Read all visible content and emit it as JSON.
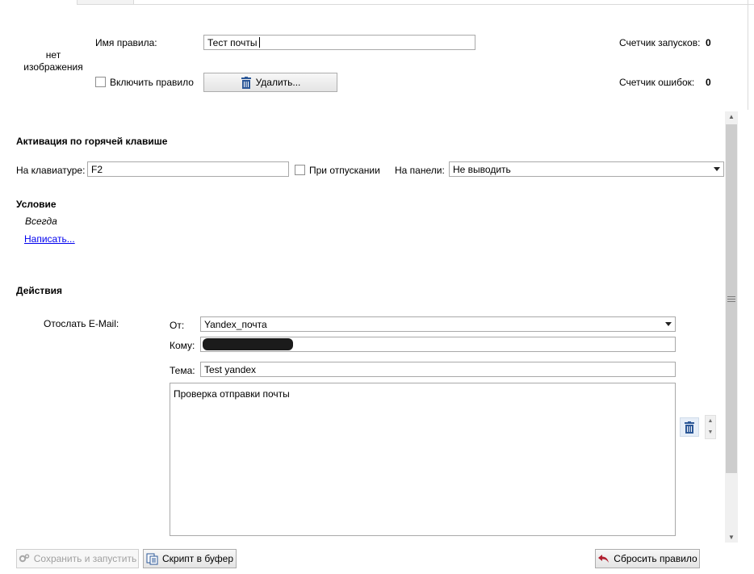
{
  "tabs": [
    "",
    ""
  ],
  "rule": {
    "no_image_text": "нет изображения",
    "name_label": "Имя правила:",
    "name_value": "Тест почты",
    "enable_label": "Включить правило",
    "delete_label": "Удалить...",
    "run_counter_label": "Счетчик запусков:",
    "run_counter_value": "0",
    "error_counter_label": "Счетчик ошибок:",
    "error_counter_value": "0"
  },
  "hotkey": {
    "section_title": "Активация по горячей клавише",
    "keyboard_label": "На клавиатуре:",
    "keyboard_value": "F2",
    "on_release_label": "При отпускании",
    "panel_label": "На панели:",
    "panel_value": "Не выводить"
  },
  "condition": {
    "section_title": "Условие",
    "value": "Всегда",
    "write_link": "Написать..."
  },
  "actions": {
    "section_title": "Действия",
    "action_name": "Отослать E-Mail:",
    "from_label": "От:",
    "from_value": "Yandex_почта",
    "to_label": "Кому:",
    "subject_label": "Тема:",
    "subject_value": "Test yandex",
    "body_value": "Проверка отправки почты"
  },
  "footer": {
    "save_run_label": "Сохранить и запустить",
    "copy_script_label": "Скрипт в буфер",
    "reset_label": "Сбросить правило"
  },
  "icons": {
    "delete": "trash-icon",
    "save_run": "gear-icon",
    "copy_script": "clipboard-icon",
    "reset": "undo-arrow-icon",
    "action_delete": "trash-icon"
  },
  "colors": {
    "accent_blue": "#2b5797",
    "reset_arrow": "#b01e2e",
    "link": "#0000ee"
  }
}
